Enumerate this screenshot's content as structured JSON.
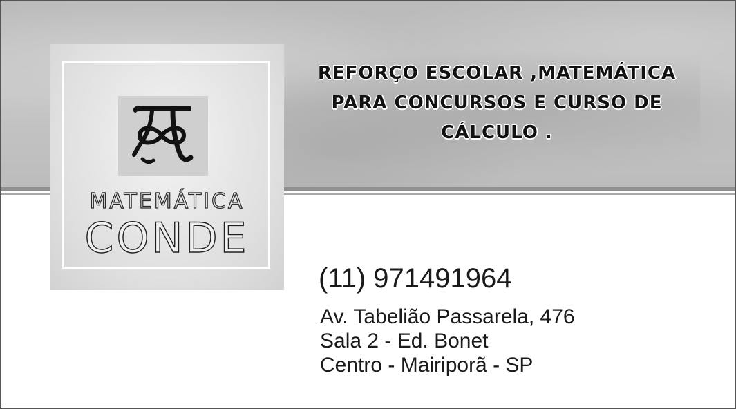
{
  "brand": {
    "line1": "MATEMÁTICA",
    "line2": "CONDE",
    "logo_icon": "pi-infinity-monogram-icon"
  },
  "slogan": {
    "lines": [
      "REFORÇO ESCOLAR ,MATEMÁTICA",
      "PARA CONCURSOS E CURSO DE",
      "CÁLCULO ."
    ]
  },
  "contact": {
    "phone": "(11) 971491964",
    "address_lines": [
      "Av. Tabelião Passarela, 476",
      "Sala 2 - Ed. Bonet",
      "Centro - Mairiporã - SP"
    ]
  },
  "colors": {
    "band": "#bdbdbd",
    "text": "#1a1a1a",
    "background": "#ffffff"
  }
}
